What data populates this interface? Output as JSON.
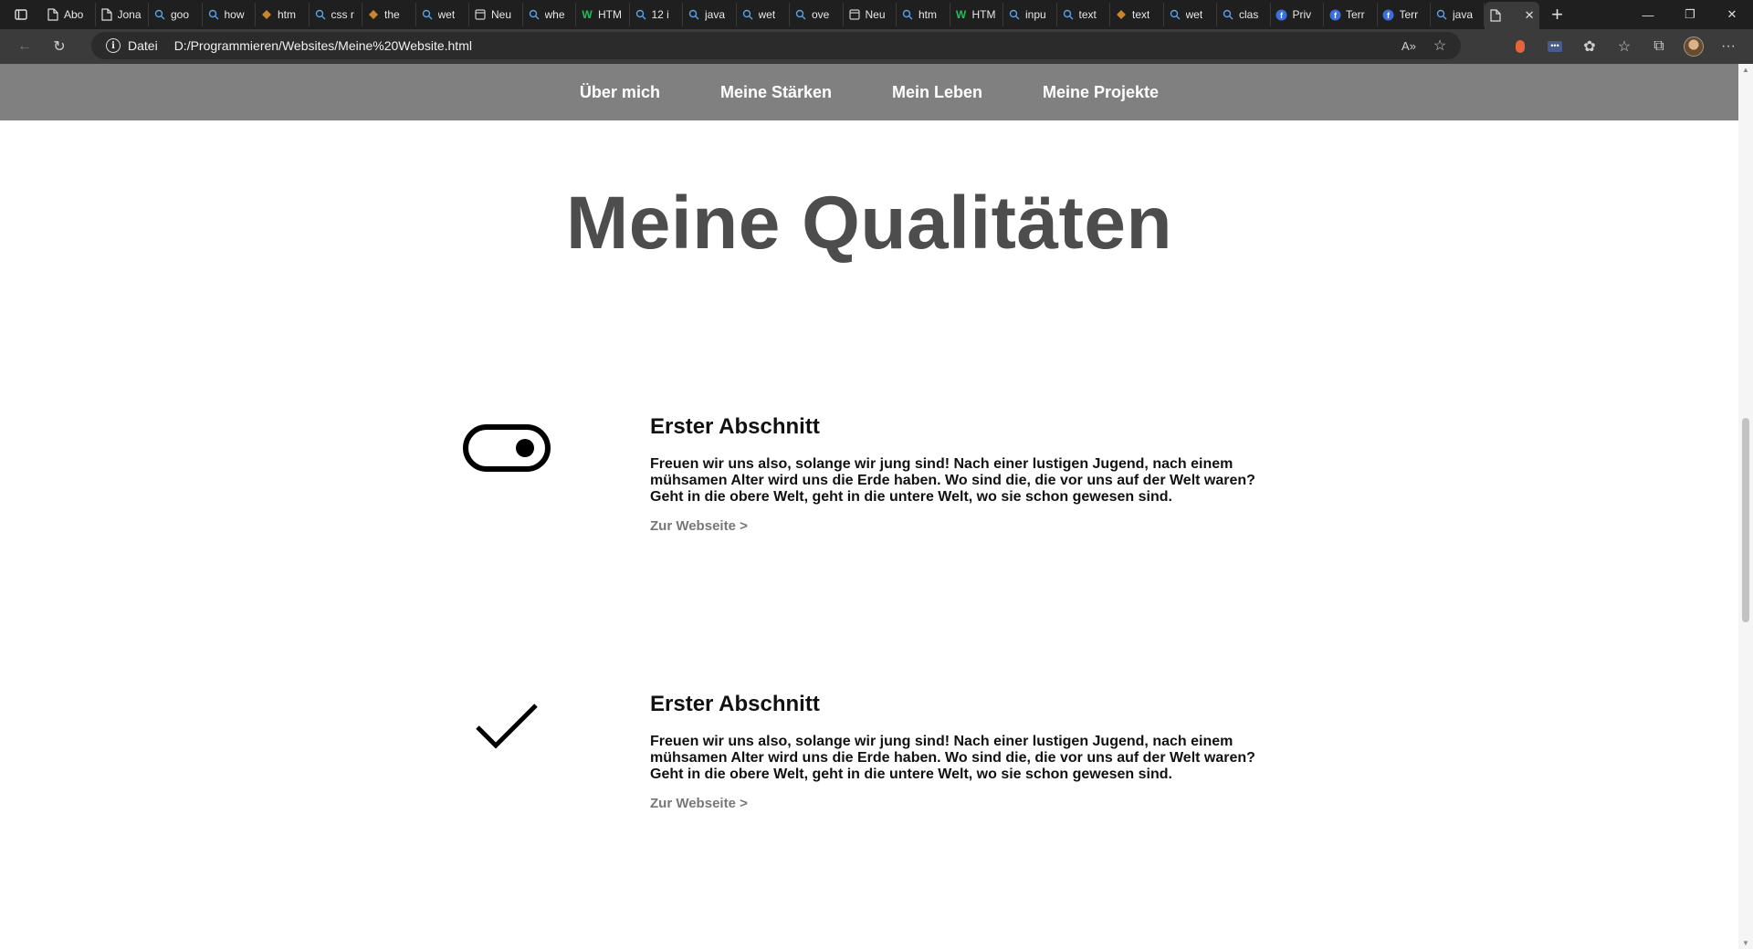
{
  "browser": {
    "tabs": [
      {
        "label": "Abo",
        "icon": "page-icon"
      },
      {
        "label": "Jona",
        "icon": "page-icon"
      },
      {
        "label": "goo",
        "icon": "search-icon"
      },
      {
        "label": "how",
        "icon": "search-icon"
      },
      {
        "label": "htm",
        "icon": "site-icon"
      },
      {
        "label": "css r",
        "icon": "search-icon"
      },
      {
        "label": "the",
        "icon": "site-icon"
      },
      {
        "label": "wet",
        "icon": "search-icon"
      },
      {
        "label": "Neu",
        "icon": "newtab-icon"
      },
      {
        "label": "whe",
        "icon": "search-icon"
      },
      {
        "label": "HTM",
        "icon": "w-icon"
      },
      {
        "label": "12 i",
        "icon": "search-icon"
      },
      {
        "label": "java",
        "icon": "search-icon"
      },
      {
        "label": "wet",
        "icon": "search-icon"
      },
      {
        "label": "ove",
        "icon": "search-icon"
      },
      {
        "label": "Neu",
        "icon": "newtab-icon"
      },
      {
        "label": "htm",
        "icon": "search-icon"
      },
      {
        "label": "HTM",
        "icon": "w-icon"
      },
      {
        "label": "inpu",
        "icon": "search-icon"
      },
      {
        "label": "text",
        "icon": "search-icon"
      },
      {
        "label": "text",
        "icon": "site-icon"
      },
      {
        "label": "wet",
        "icon": "search-icon"
      },
      {
        "label": "clas",
        "icon": "search-icon"
      },
      {
        "label": "Priv",
        "icon": "f-icon"
      },
      {
        "label": "Terr",
        "icon": "f-icon"
      },
      {
        "label": "Terr",
        "icon": "f-icon"
      },
      {
        "label": "java",
        "icon": "search-icon"
      }
    ],
    "active_tab_icon": "page-icon",
    "address": {
      "scheme_label": "Datei",
      "url": "D:/Programmieren/Websites/Meine%20Website.html"
    }
  },
  "site": {
    "nav": [
      "Über mich",
      "Meine Stärken",
      "Mein Leben",
      "Meine Projekte"
    ],
    "title": "Meine Qualitäten",
    "sections": [
      {
        "icon": "toggle-icon",
        "heading": "Erster Abschnitt",
        "body": "Freuen wir uns also, solange wir jung sind! Nach einer lustigen Jugend, nach einem mühsamen Alter wird uns die Erde haben. Wo sind die, die vor uns auf der Welt waren? Geht in die obere Welt, geht in die untere Welt, wo sie schon gewesen sind.",
        "link": "Zur Webseite >"
      },
      {
        "icon": "checkmark-icon",
        "heading": "Erster Abschnitt",
        "body": "Freuen wir uns also, solange wir jung sind! Nach einer lustigen Jugend, nach einem mühsamen Alter wird uns die Erde haben. Wo sind die, die vor uns auf der Welt waren? Geht in die obere Welt, geht in die untere Welt, wo sie schon gewesen sind.",
        "link": "Zur Webseite >"
      }
    ]
  },
  "colors": {
    "nav_bg": "#808080",
    "title": "#4d4d4d",
    "link": "#777777"
  }
}
